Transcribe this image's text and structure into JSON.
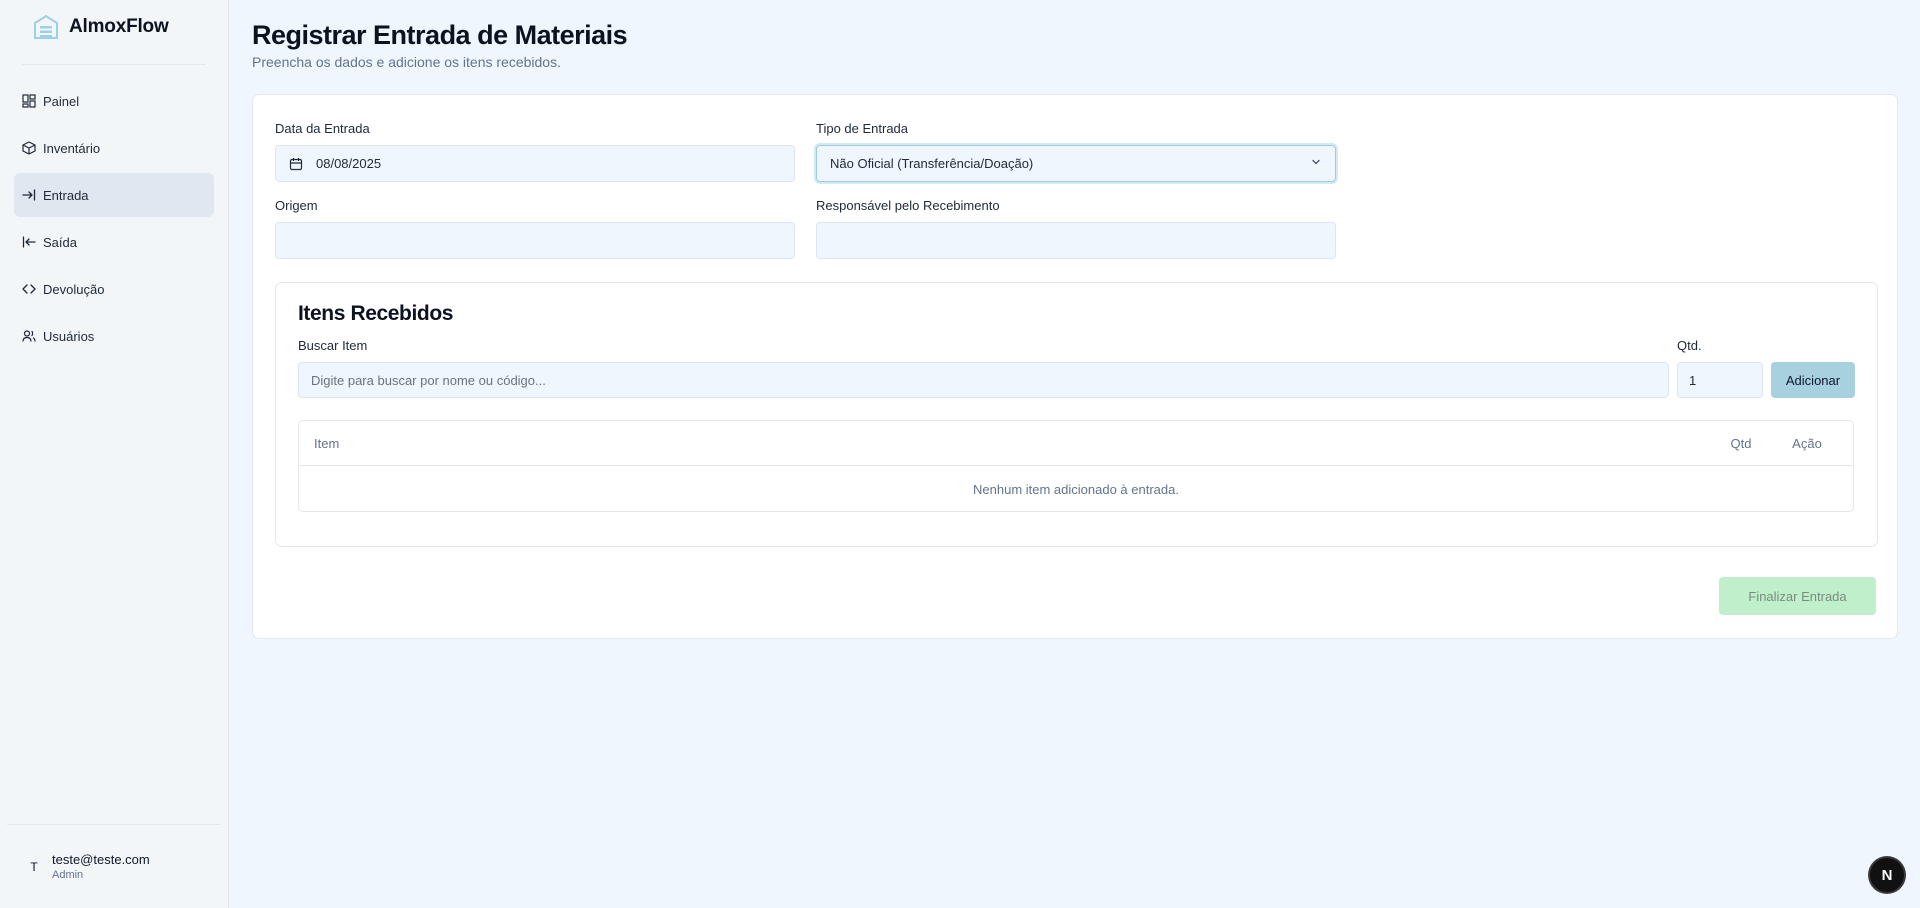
{
  "app": {
    "name": "AlmoxFlow",
    "logo_icon": "warehouse-icon",
    "accent": "#a7d1df"
  },
  "sidebar": {
    "items": [
      {
        "label": "Painel",
        "icon": "dashboard-icon",
        "active": false
      },
      {
        "label": "Inventário",
        "icon": "package-icon",
        "active": false
      },
      {
        "label": "Entrada",
        "icon": "arrow-in-icon",
        "active": true
      },
      {
        "label": "Saída",
        "icon": "arrow-out-icon",
        "active": false
      },
      {
        "label": "Devolução",
        "icon": "code-arrows-icon",
        "active": false
      },
      {
        "label": "Usuários",
        "icon": "users-icon",
        "active": false
      }
    ],
    "user": {
      "avatar": "T",
      "email": "teste@teste.com",
      "role": "Admin"
    }
  },
  "page": {
    "title": "Registrar Entrada de Materiais",
    "subtitle": "Preencha os dados e adicione os itens recebidos."
  },
  "form": {
    "date_label": "Data da Entrada",
    "date_value": "08/08/2025",
    "type_label": "Tipo de Entrada",
    "type_value": "Não Oficial (Transferência/Doação)",
    "origin_label": "Origem",
    "origin_value": "",
    "responsible_label": "Responsável pelo Recebimento",
    "responsible_value": ""
  },
  "items": {
    "title": "Itens Recebidos",
    "search_label": "Buscar Item",
    "search_placeholder": "Digite para buscar por nome ou código...",
    "qty_label": "Qtd.",
    "qty_value": "1",
    "add_button": "Adicionar",
    "table": {
      "headers": {
        "item": "Item",
        "qtd": "Qtd",
        "acao": "Ação"
      },
      "empty": "Nenhum item adicionado à entrada."
    }
  },
  "actions": {
    "finish_button": "Finalizar Entrada",
    "finish_color": "#c0f0cb"
  },
  "next_badge": "N"
}
